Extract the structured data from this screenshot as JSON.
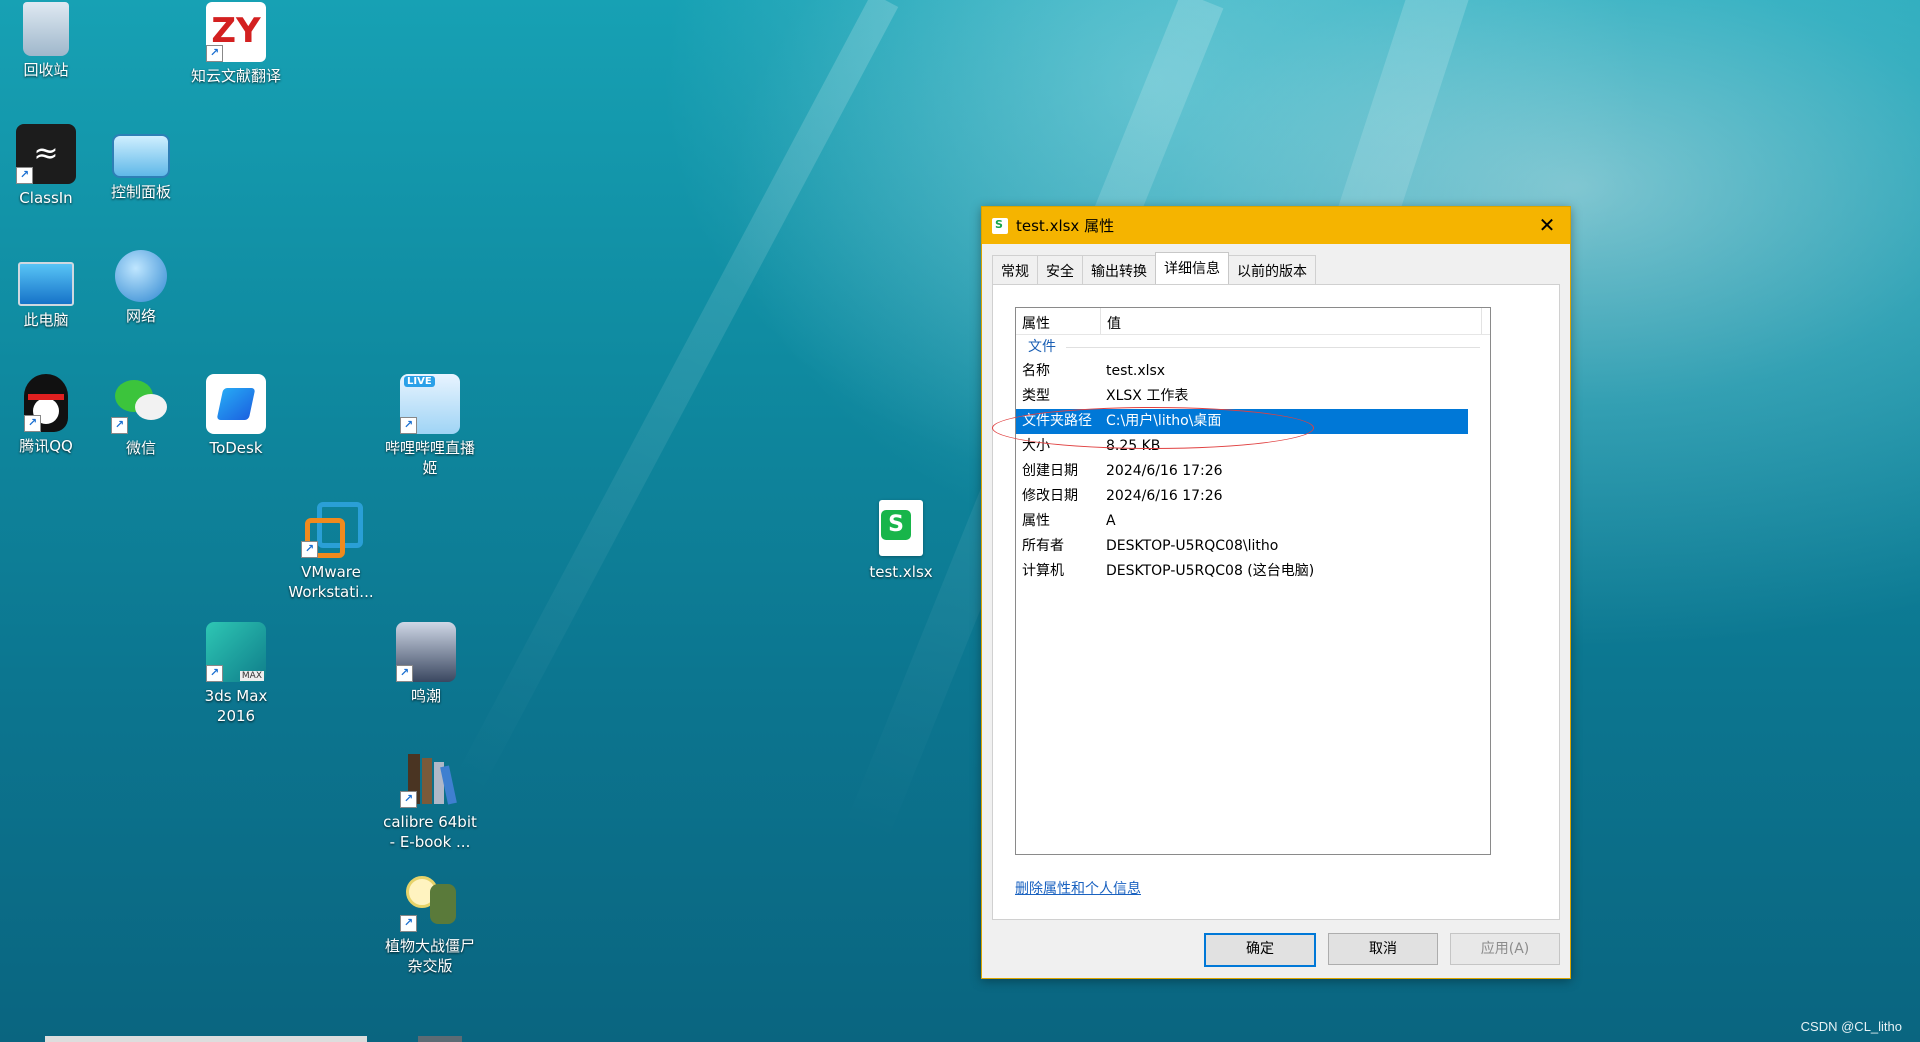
{
  "desktop": {
    "icons": [
      {
        "label": "回收站",
        "name": "recycle-bin"
      },
      {
        "label": "知云文献翻译",
        "name": "zhiyun-translate",
        "text": "ZY"
      },
      {
        "label": "ClassIn",
        "name": "classin"
      },
      {
        "label": "控制面板",
        "name": "control-panel"
      },
      {
        "label": "此电脑",
        "name": "this-pc"
      },
      {
        "label": "网络",
        "name": "network"
      },
      {
        "label": "腾讯QQ",
        "name": "qq"
      },
      {
        "label": "微信",
        "name": "wechat"
      },
      {
        "label": "ToDesk",
        "name": "todesk"
      },
      {
        "label": "哔哩哔哩直播姬",
        "name": "bilibili-live",
        "badge": "LIVE"
      },
      {
        "label": "VMware Workstati...",
        "name": "vmware"
      },
      {
        "label": "3ds Max 2016",
        "name": "3dsmax",
        "badge": "MAX"
      },
      {
        "label": "鸣潮",
        "name": "wuthering-waves"
      },
      {
        "label": "calibre 64bit - E-book ...",
        "name": "calibre"
      },
      {
        "label": "植物大战僵尸杂交版",
        "name": "pvz-hybrid"
      },
      {
        "label": "test.xlsx",
        "name": "test-xlsx-file"
      }
    ],
    "watermark": "CSDN @CL_litho"
  },
  "dialog": {
    "title": "test.xlsx 属性",
    "close_glyph": "✕",
    "tabs": [
      "常规",
      "安全",
      "输出转换",
      "详细信息",
      "以前的版本"
    ],
    "active_tab": "详细信息",
    "columns": {
      "property": "属性",
      "value": "值"
    },
    "group": "文件",
    "rows": [
      {
        "k": "名称",
        "v": "test.xlsx"
      },
      {
        "k": "类型",
        "v": "XLSX 工作表"
      },
      {
        "k": "文件夹路径",
        "v": "C:\\用户\\litho\\桌面"
      },
      {
        "k": "大小",
        "v": "8.25 KB"
      },
      {
        "k": "创建日期",
        "v": "2024/6/16 17:26"
      },
      {
        "k": "修改日期",
        "v": "2024/6/16 17:26"
      },
      {
        "k": "属性",
        "v": "A"
      },
      {
        "k": "所有者",
        "v": "DESKTOP-U5RQC08\\litho"
      },
      {
        "k": "计算机",
        "v": "DESKTOP-U5RQC08 (这台电脑)"
      }
    ],
    "link": "删除属性和个人信息",
    "buttons": {
      "ok": "确定",
      "cancel": "取消",
      "apply": "应用(A)"
    },
    "colors": {
      "titlebar": "#f5b400",
      "selection": "#0078d7",
      "annotation": "#e04040"
    }
  }
}
